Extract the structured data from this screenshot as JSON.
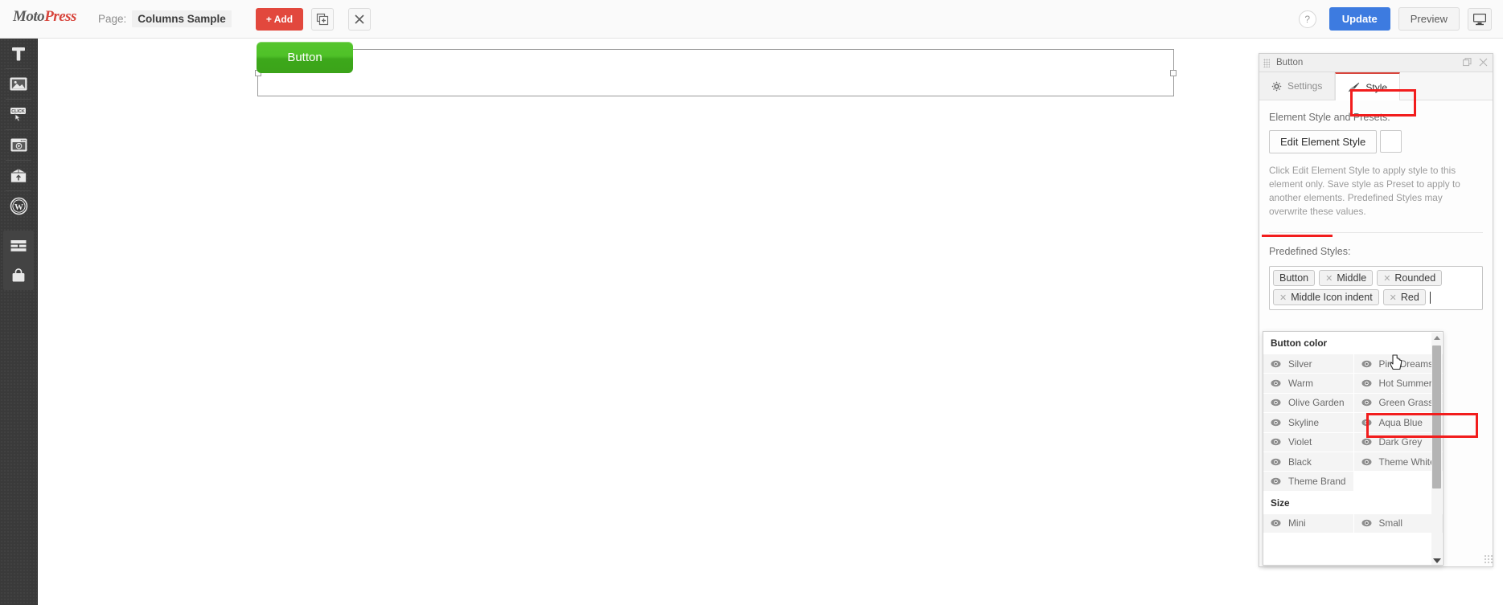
{
  "topbar": {
    "logo_moto": "Moto",
    "logo_press": "Press",
    "page_label": "Page:",
    "page_title": "Columns Sample",
    "add_label": "+ Add",
    "duplicate_icon": "duplicate-icon",
    "close_icon": "close-icon",
    "help_label": "?",
    "update_label": "Update",
    "preview_label": "Preview",
    "device_icon": "desktop-monitor-icon"
  },
  "sidebar": {
    "items": [
      {
        "icon": "text-tool-icon",
        "name": "text"
      },
      {
        "icon": "image-icon",
        "name": "image"
      },
      {
        "icon": "click-button-icon",
        "name": "button"
      },
      {
        "icon": "video-player-icon",
        "name": "video"
      },
      {
        "icon": "package-box-icon",
        "name": "package"
      },
      {
        "icon": "wordpress-icon",
        "name": "wordpress"
      },
      {
        "icon": "rows-layout-icon",
        "name": "rows"
      },
      {
        "icon": "shopping-bag-icon",
        "name": "shop"
      }
    ]
  },
  "canvas": {
    "button_label": "Button"
  },
  "panel": {
    "title": "Button",
    "restore_icon": "restore-window-icon",
    "close_icon": "close-icon",
    "tabs": [
      {
        "label": "Settings",
        "icon": "gear-icon",
        "active": false
      },
      {
        "label": "Style",
        "icon": "paintbrush-icon",
        "active": true
      }
    ],
    "element_style_label": "Element Style and Presets:",
    "edit_element_style_label": "Edit Element Style",
    "hint": "Click Edit Element Style to apply style to this element only. Save style as Preset to apply to another elements. Predefined Styles may overwrite these values.",
    "predefined_styles_label": "Predefined Styles:",
    "tags": [
      {
        "label": "Button",
        "removable": false
      },
      {
        "label": "Middle",
        "removable": true
      },
      {
        "label": "Rounded",
        "removable": true
      },
      {
        "label": "Middle Icon indent",
        "removable": true
      },
      {
        "label": "Red",
        "removable": true
      }
    ],
    "tag_input_value": ""
  },
  "dropdown": {
    "groups": [
      {
        "title": "Button color",
        "items": [
          "Silver",
          "Pink Dreams",
          "Warm",
          "Hot Summer",
          "Olive Garden",
          "Green Grass",
          "Skyline",
          "Aqua Blue",
          "Violet",
          "Dark Grey",
          "Black",
          "Theme White",
          "Theme Brand",
          ""
        ],
        "highlighted": "Green Grass"
      },
      {
        "title": "Size",
        "items": [
          "Mini",
          "Small"
        ]
      }
    ],
    "item_icon": "eye-icon",
    "scroll_up_icon": "scroll-up-arrow-icon",
    "scroll_down_icon": "scroll-down-arrow-icon"
  },
  "colors": {
    "accent_red": "#e2483d",
    "highlight_red": "#f21d1d",
    "update_blue": "#3d7be0",
    "button_green_top": "#55c52c",
    "button_green_bottom": "#3ba319"
  }
}
